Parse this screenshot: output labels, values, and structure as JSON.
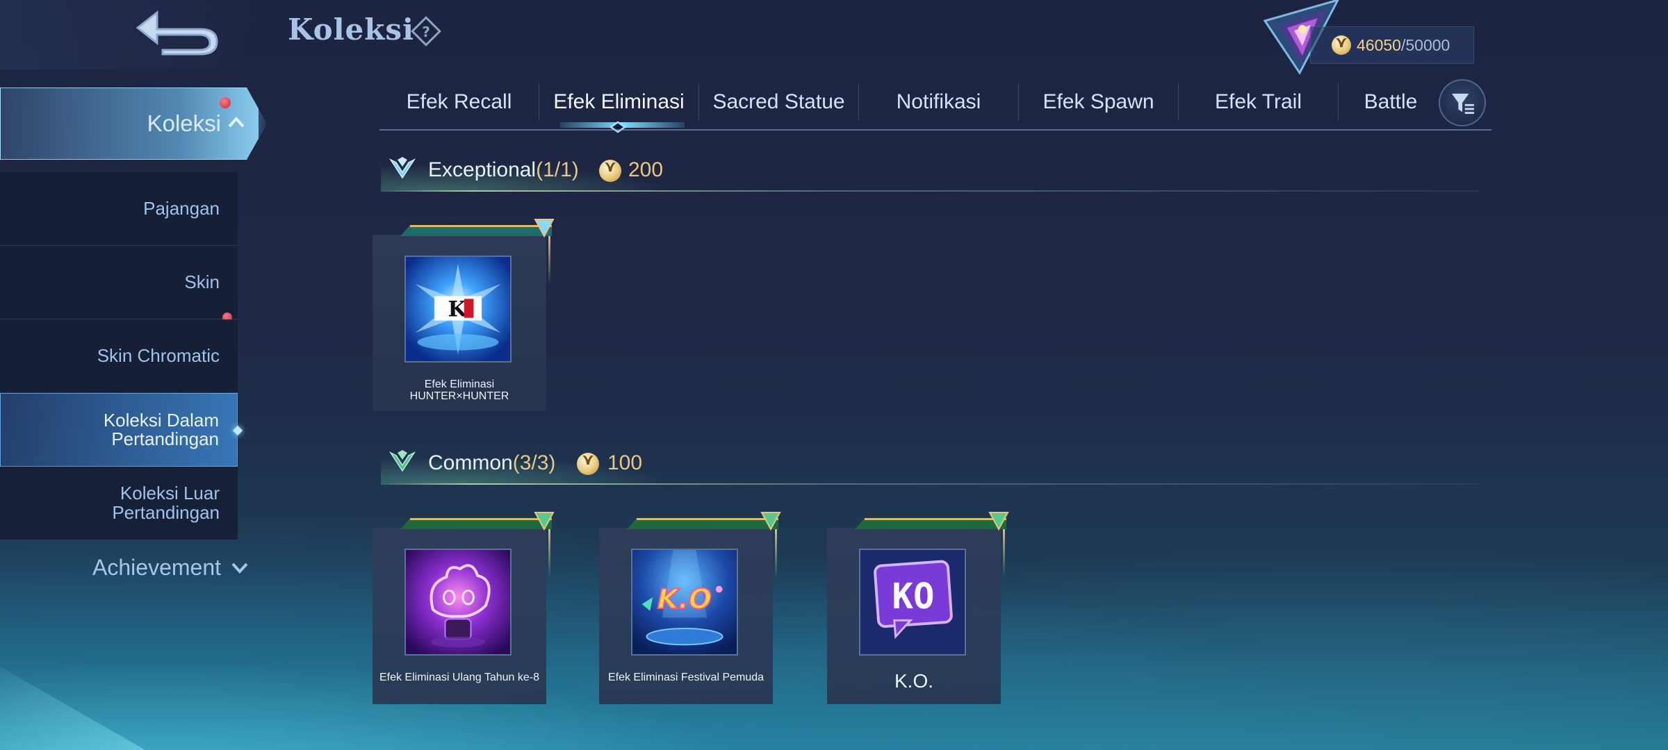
{
  "header": {
    "title": "Koleksi",
    "points_current": "46050",
    "points_max": "/50000"
  },
  "sidebar": {
    "active_group": "Koleksi",
    "items": [
      {
        "label": "Pajangan"
      },
      {
        "label": "Skin"
      },
      {
        "label": "Skin Chromatic"
      },
      {
        "label": "Koleksi Dalam Pertandingan"
      },
      {
        "label": "Koleksi Luar Pertandingan"
      }
    ],
    "collapsed_group": "Achievement"
  },
  "tabs": [
    {
      "label": "Efek Recall"
    },
    {
      "label": "Efek Eliminasi"
    },
    {
      "label": "Sacred Statue"
    },
    {
      "label": "Notifikasi"
    },
    {
      "label": "Efek Spawn"
    },
    {
      "label": "Efek Trail"
    },
    {
      "label": "Battle"
    }
  ],
  "sections": {
    "exceptional": {
      "title": "Exceptional",
      "count": "(1/1)",
      "points": "200",
      "items": [
        {
          "name": "Efek Eliminasi HUNTER×HUNTER"
        }
      ]
    },
    "common": {
      "title": "Common",
      "count": "(3/3)",
      "points": "100",
      "items": [
        {
          "name": "Efek Eliminasi Ulang Tahun ke-8"
        },
        {
          "name": "Efek Eliminasi Festival Pemuda"
        },
        {
          "name": "K.O."
        }
      ]
    }
  },
  "thumb_text": {
    "hunter": "K",
    "ko_banner": "K.O",
    "ko_bubble": "KO"
  },
  "colors": {
    "accent_gold": "#e6c786",
    "accent_cyan": "#7fdcff",
    "badge_red": "#c8203a"
  }
}
